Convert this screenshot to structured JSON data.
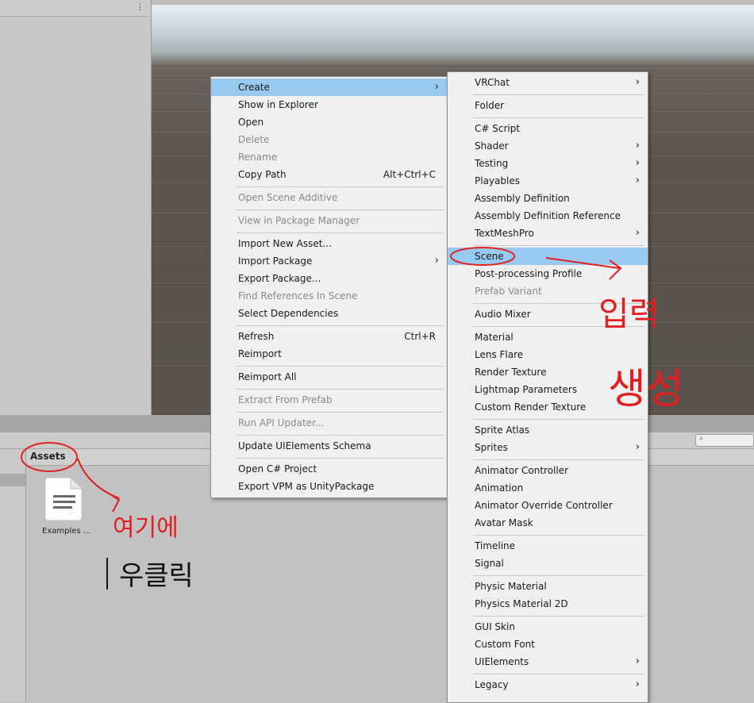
{
  "context_menu": {
    "items": [
      {
        "label": "Create",
        "shortcut": "",
        "submenu": true,
        "disabled": false,
        "highlighted": true
      },
      {
        "label": "Show in Explorer",
        "shortcut": "",
        "submenu": false,
        "disabled": false
      },
      {
        "label": "Open",
        "shortcut": "",
        "submenu": false,
        "disabled": false
      },
      {
        "label": "Delete",
        "shortcut": "",
        "submenu": false,
        "disabled": true
      },
      {
        "label": "Rename",
        "shortcut": "",
        "submenu": false,
        "disabled": true
      },
      {
        "label": "Copy Path",
        "shortcut": "Alt+Ctrl+C",
        "submenu": false,
        "disabled": false
      },
      {
        "label": "Open Scene Additive",
        "shortcut": "",
        "submenu": false,
        "disabled": true
      },
      {
        "label": "View in Package Manager",
        "shortcut": "",
        "submenu": false,
        "disabled": true
      },
      {
        "label": "Import New Asset...",
        "shortcut": "",
        "submenu": false,
        "disabled": false
      },
      {
        "label": "Import Package",
        "shortcut": "",
        "submenu": true,
        "disabled": false
      },
      {
        "label": "Export Package...",
        "shortcut": "",
        "submenu": false,
        "disabled": false
      },
      {
        "label": "Find References In Scene",
        "shortcut": "",
        "submenu": false,
        "disabled": true
      },
      {
        "label": "Select Dependencies",
        "shortcut": "",
        "submenu": false,
        "disabled": false
      },
      {
        "label": "Refresh",
        "shortcut": "Ctrl+R",
        "submenu": false,
        "disabled": false
      },
      {
        "label": "Reimport",
        "shortcut": "",
        "submenu": false,
        "disabled": false
      },
      {
        "label": "Reimport All",
        "shortcut": "",
        "submenu": false,
        "disabled": false
      },
      {
        "label": "Extract From Prefab",
        "shortcut": "",
        "submenu": false,
        "disabled": true
      },
      {
        "label": "Run API Updater...",
        "shortcut": "",
        "submenu": false,
        "disabled": true
      },
      {
        "label": "Update UIElements Schema",
        "shortcut": "",
        "submenu": false,
        "disabled": false
      },
      {
        "label": "Open C# Project",
        "shortcut": "",
        "submenu": false,
        "disabled": false
      },
      {
        "label": "Export VPM as UnityPackage",
        "shortcut": "",
        "submenu": false,
        "disabled": false
      }
    ]
  },
  "create_submenu": {
    "items": [
      {
        "label": "VRChat",
        "submenu": true,
        "disabled": false
      },
      {
        "label": "Folder",
        "submenu": false,
        "disabled": false
      },
      {
        "label": "C# Script",
        "submenu": false,
        "disabled": false
      },
      {
        "label": "Shader",
        "submenu": true,
        "disabled": false
      },
      {
        "label": "Testing",
        "submenu": true,
        "disabled": false
      },
      {
        "label": "Playables",
        "submenu": true,
        "disabled": false
      },
      {
        "label": "Assembly Definition",
        "submenu": false,
        "disabled": false
      },
      {
        "label": "Assembly Definition Reference",
        "submenu": false,
        "disabled": false
      },
      {
        "label": "TextMeshPro",
        "submenu": true,
        "disabled": false
      },
      {
        "label": "Scene",
        "submenu": false,
        "disabled": false,
        "highlighted": true
      },
      {
        "label": "Post-processing Profile",
        "submenu": false,
        "disabled": false
      },
      {
        "label": "Prefab Variant",
        "submenu": false,
        "disabled": true
      },
      {
        "label": "Audio Mixer",
        "submenu": false,
        "disabled": false
      },
      {
        "label": "Material",
        "submenu": false,
        "disabled": false
      },
      {
        "label": "Lens Flare",
        "submenu": false,
        "disabled": false
      },
      {
        "label": "Render Texture",
        "submenu": false,
        "disabled": false
      },
      {
        "label": "Lightmap Parameters",
        "submenu": false,
        "disabled": false
      },
      {
        "label": "Custom Render Texture",
        "submenu": false,
        "disabled": false
      },
      {
        "label": "Sprite Atlas",
        "submenu": false,
        "disabled": false
      },
      {
        "label": "Sprites",
        "submenu": true,
        "disabled": false
      },
      {
        "label": "Animator Controller",
        "submenu": false,
        "disabled": false
      },
      {
        "label": "Animation",
        "submenu": false,
        "disabled": false
      },
      {
        "label": "Animator Override Controller",
        "submenu": false,
        "disabled": false
      },
      {
        "label": "Avatar Mask",
        "submenu": false,
        "disabled": false
      },
      {
        "label": "Timeline",
        "submenu": false,
        "disabled": false
      },
      {
        "label": "Signal",
        "submenu": false,
        "disabled": false
      },
      {
        "label": "Physic Material",
        "submenu": false,
        "disabled": false
      },
      {
        "label": "Physics Material 2D",
        "submenu": false,
        "disabled": false
      },
      {
        "label": "GUI Skin",
        "submenu": false,
        "disabled": false
      },
      {
        "label": "Custom Font",
        "submenu": false,
        "disabled": false
      },
      {
        "label": "UIElements",
        "submenu": true,
        "disabled": false
      },
      {
        "label": "Legacy",
        "submenu": true,
        "disabled": false
      }
    ]
  },
  "project": {
    "tab_label": "Assets",
    "files": [
      {
        "name": "Examples ...",
        "icon": "text-file-icon"
      }
    ]
  },
  "hierarchy": {
    "menu_icon": "kebab-menu-icon"
  },
  "annotations": [
    {
      "text": "여기에",
      "color": "#e02020"
    },
    {
      "text": "우클릭",
      "color": "#111111"
    },
    {
      "text": "입력",
      "color": "#e02020"
    },
    {
      "text": "생성",
      "color": "#e02020"
    }
  ],
  "colors": {
    "highlight": "#99c9ef",
    "menu_bg": "#f0f0f0",
    "annotation_red": "#e02020"
  }
}
